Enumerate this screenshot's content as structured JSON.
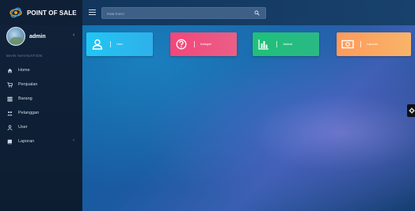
{
  "brand": {
    "title": "POINT OF SALE"
  },
  "user": {
    "name": "admin"
  },
  "nav": {
    "header": "MAIN NAVIGATION",
    "items": [
      {
        "label": "Home",
        "icon": "home-icon"
      },
      {
        "label": "Penjualan",
        "icon": "cart-icon"
      },
      {
        "label": "Barang",
        "icon": "list-icon"
      },
      {
        "label": "Pelanggan",
        "icon": "users-icon"
      },
      {
        "label": "User",
        "icon": "user-icon"
      },
      {
        "label": "Laporan",
        "icon": "book-icon"
      }
    ]
  },
  "search": {
    "placeholder": "Kata Kunci",
    "value": ""
  },
  "cards": [
    {
      "label": "User",
      "icon": "user-icon",
      "color": "#21c6f3"
    },
    {
      "label": "Kategori",
      "icon": "question-icon",
      "color": "#f3467a"
    },
    {
      "label": "Jadwal",
      "icon": "bar-chart-icon",
      "color": "#1fc07a"
    },
    {
      "label": "Laporan",
      "icon": "money-icon",
      "color": "#ff9a5a"
    }
  ]
}
